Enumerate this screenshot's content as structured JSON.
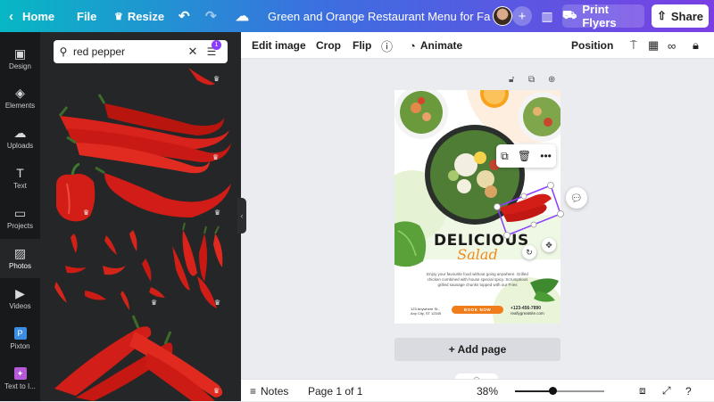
{
  "topbar": {
    "home_label": "Home",
    "file_label": "File",
    "resize_label": "Resize",
    "doc_title": "Green and Orange Restaurant Menu for Fa ...",
    "print_label": "Print Flyers",
    "share_label": "Share"
  },
  "rail": {
    "items": [
      {
        "label": "Design",
        "icon": "design-icon"
      },
      {
        "label": "Elements",
        "icon": "elements-icon"
      },
      {
        "label": "Uploads",
        "icon": "uploads-icon"
      },
      {
        "label": "Text",
        "icon": "text-icon"
      },
      {
        "label": "Projects",
        "icon": "projects-icon"
      },
      {
        "label": "Photos",
        "icon": "photos-icon"
      },
      {
        "label": "Videos",
        "icon": "videos-icon"
      },
      {
        "label": "Pixton",
        "icon": "pixton-icon"
      },
      {
        "label": "Text to I...",
        "icon": "text-to-image-icon"
      }
    ],
    "active": "Photos"
  },
  "search": {
    "value": "red pepper",
    "filter_count": "1"
  },
  "edit_toolbar": {
    "edit_image": "Edit image",
    "crop": "Crop",
    "flip": "Flip",
    "animate": "Animate",
    "position": "Position"
  },
  "design": {
    "headline": "DELICIOUS",
    "script_word": "Salad",
    "description": "Enjoy your favourite food without going anywhere. Grilled chicken combined with house special spicy. Scrumptious grilled sausage chunks topped with our Fries",
    "address": "123 Anywhere St., Any City, ST 12345",
    "book_button": "BOOK NOW",
    "phone": "+123-456-7890",
    "website": "reallygreatsite.com"
  },
  "canvas": {
    "add_page_label": "+ Add page"
  },
  "bottombar": {
    "notes_label": "Notes",
    "page_indicator": "Page 1 of 1",
    "zoom_label": "38%",
    "zoom_fraction": 0.38
  },
  "colors": {
    "panel_bg": "#252627",
    "rail_bg": "#18191b",
    "accent_purple": "#8b3dff",
    "book_orange": "#f07c1a"
  }
}
